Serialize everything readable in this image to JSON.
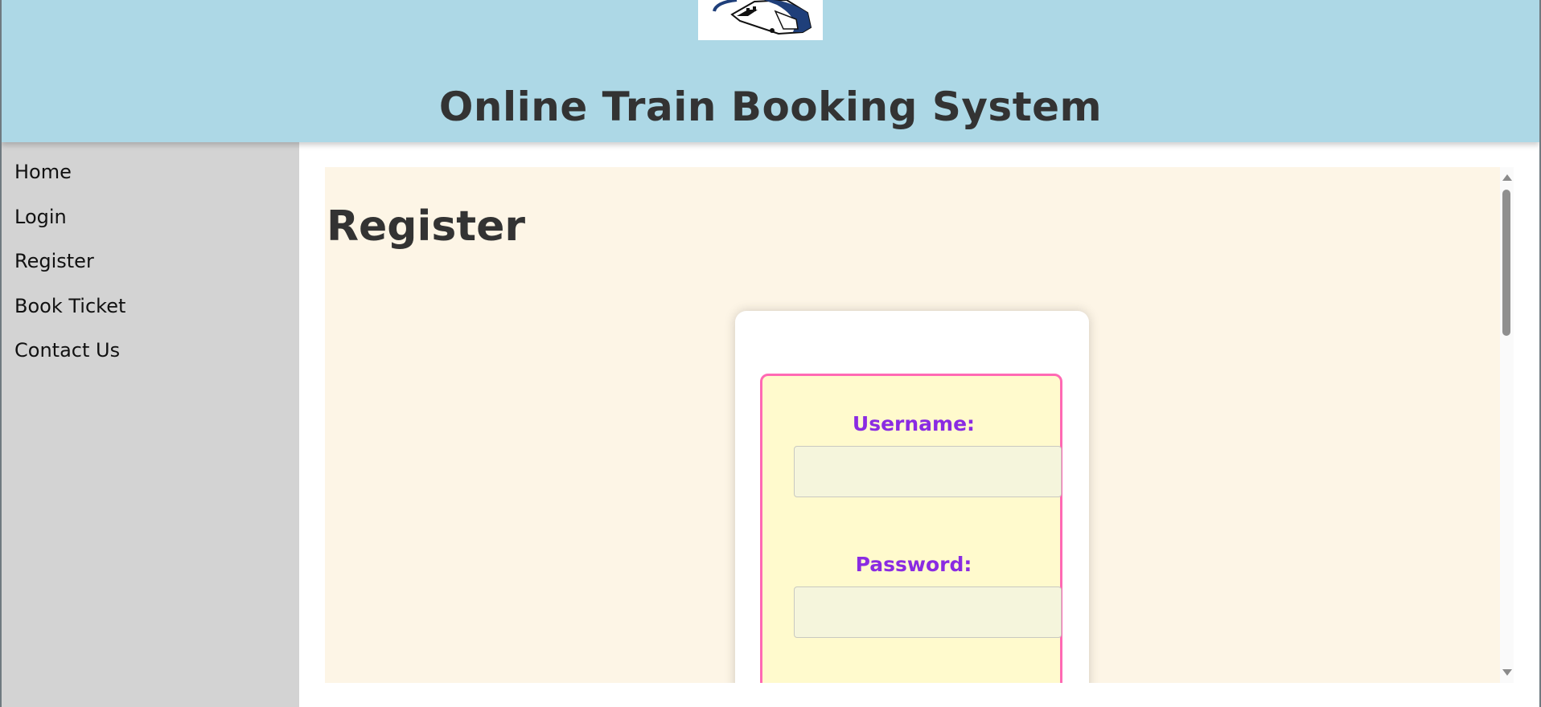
{
  "header": {
    "logo_icon": "train-logo-icon",
    "title": "Online Train Booking System"
  },
  "sidebar": {
    "items": [
      {
        "label": "Home"
      },
      {
        "label": "Login"
      },
      {
        "label": "Register"
      },
      {
        "label": "Book Ticket"
      },
      {
        "label": "Contact Us"
      }
    ]
  },
  "main": {
    "heading": "Register",
    "form": {
      "username_label": "Username:",
      "username_value": "",
      "password_label": "Password:",
      "password_value": ""
    }
  },
  "colors": {
    "header_bg": "#add8e6",
    "sidebar_bg": "#d3d3d3",
    "content_bg": "#fdf5e6",
    "form_bg": "#fffacd",
    "form_border": "#ff69b4",
    "label_color": "#8a2be2",
    "input_bg": "#f5f5dc"
  }
}
